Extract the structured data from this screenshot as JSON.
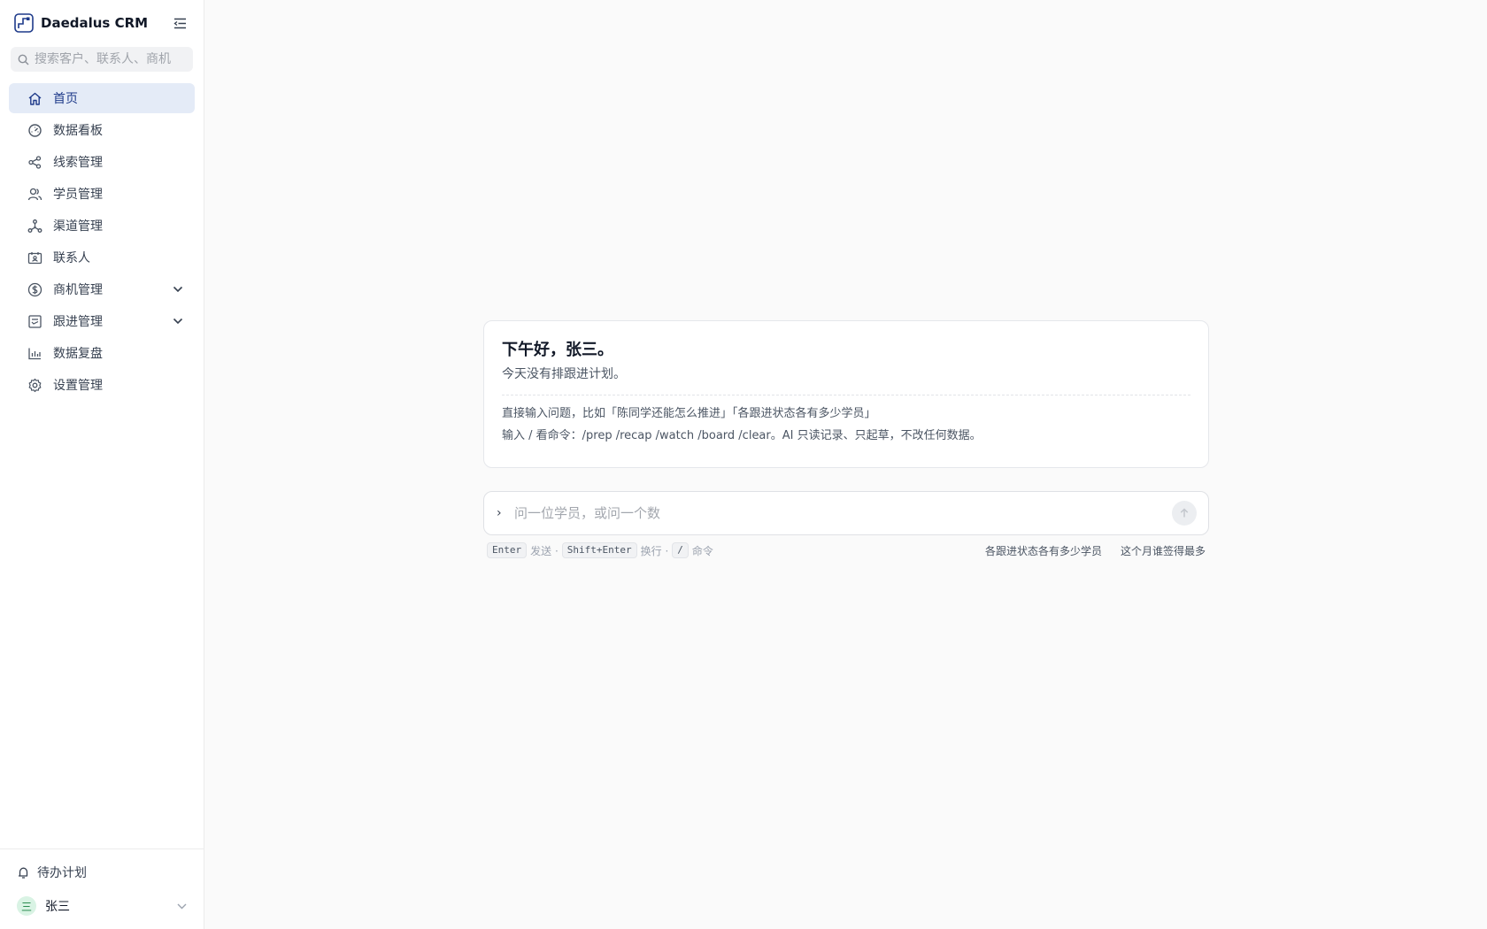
{
  "app": {
    "name": "Daedalus CRM"
  },
  "search": {
    "placeholder": "搜索客户、联系人、商机"
  },
  "nav": [
    {
      "label": "首页",
      "icon": "home-icon",
      "active": true
    },
    {
      "label": "数据看板",
      "icon": "gauge-icon"
    },
    {
      "label": "线索管理",
      "icon": "share-icon"
    },
    {
      "label": "学员管理",
      "icon": "users-icon"
    },
    {
      "label": "渠道管理",
      "icon": "network-icon"
    },
    {
      "label": "联系人",
      "icon": "contact-card-icon"
    },
    {
      "label": "商机管理",
      "icon": "dollar-icon",
      "expandable": true
    },
    {
      "label": "跟进管理",
      "icon": "checklist-icon",
      "expandable": true
    },
    {
      "label": "数据复盘",
      "icon": "bar-chart-icon"
    },
    {
      "label": "设置管理",
      "icon": "gear-icon"
    }
  ],
  "footer": {
    "todo_label": "待办计划",
    "user_name": "张三",
    "avatar_text": "三"
  },
  "welcome": {
    "greeting": "下午好，张三。",
    "subline": "今天没有排跟进计划。",
    "hint1": "直接输入问题，比如「陈同学还能怎么推进」「各跟进状态各有多少学员」",
    "hint2": "输入 / 看命令：/prep /recap /watch /board /clear。AI 只读记录、只起草，不改任何数据。"
  },
  "chat": {
    "placeholder": "问一位学员，或问一个数",
    "prompt_glyph": "›"
  },
  "shortcuts": {
    "enter_key": "Enter",
    "enter_action": "发送 ·",
    "shift_key": "Shift+Enter",
    "shift_action": "换行 ·",
    "slash_key": "/",
    "slash_action": "命令"
  },
  "suggestions": [
    "各跟进状态各有多少学员",
    "这个月谁签得最多"
  ],
  "colors": {
    "active_bg": "#e4ebf7",
    "active_text": "#1e3a8a",
    "avatar_bg": "#d9f3e4"
  }
}
